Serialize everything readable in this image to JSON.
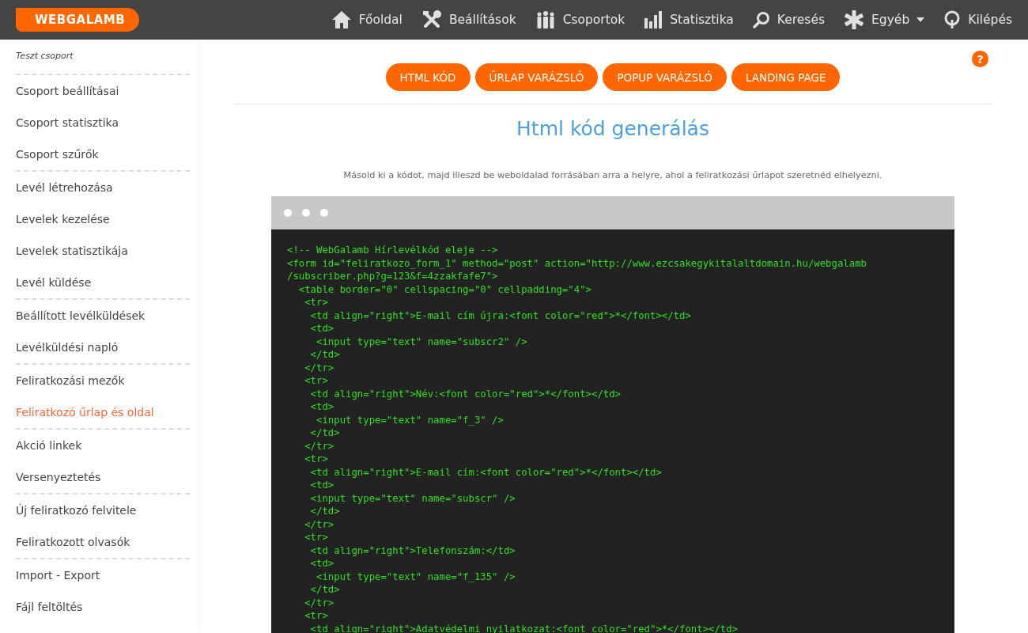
{
  "brand": {
    "logo": "WEBGALAMB"
  },
  "nav": [
    {
      "label": "Főoldal",
      "kind": "home",
      "dropdown": false
    },
    {
      "label": "Beállítások",
      "kind": "tools",
      "dropdown": false
    },
    {
      "label": "Csoportok",
      "kind": "people",
      "dropdown": false
    },
    {
      "label": "Statisztika",
      "kind": "chart",
      "dropdown": false
    },
    {
      "label": "Keresés",
      "kind": "search",
      "dropdown": false
    },
    {
      "label": "Egyéb",
      "kind": "asterisk",
      "dropdown": true
    },
    {
      "label": "Kilépés",
      "kind": "power",
      "dropdown": false
    }
  ],
  "sidebar": {
    "title": "Teszt csoport",
    "groups": [
      [
        {
          "label": "Csoport beállításai",
          "selected": false
        },
        {
          "label": "Csoport statisztika",
          "selected": false
        },
        {
          "label": "Csoport szűrők",
          "selected": false
        }
      ],
      [
        {
          "label": "Levél létrehozása",
          "selected": false
        },
        {
          "label": "Levelek kezelése",
          "selected": false
        },
        {
          "label": "Levelek statisztikája",
          "selected": false
        },
        {
          "label": "Levél küldése",
          "selected": false
        }
      ],
      [
        {
          "label": "Beállított levélküldések",
          "selected": false
        },
        {
          "label": "Levélküldési napló",
          "selected": false
        }
      ],
      [
        {
          "label": "Feliratkozási mezők",
          "selected": false
        },
        {
          "label": "Feliratkozó űrlap és oldal",
          "selected": true
        }
      ],
      [
        {
          "label": "Akció linkek",
          "selected": false
        },
        {
          "label": "Versenyeztetés",
          "selected": false
        }
      ],
      [
        {
          "label": "Új feliratkozó felvitele",
          "selected": false
        },
        {
          "label": "Feliratkozott olvasók",
          "selected": false
        }
      ],
      [
        {
          "label": "Import - Export",
          "selected": false
        },
        {
          "label": "Fájl feltöltés",
          "selected": false
        }
      ]
    ]
  },
  "help": {
    "label": "?"
  },
  "tabs": [
    "HTML KÓD",
    "ŰRLAP VARÁZSLÓ",
    "POPUP VARÁZSLÓ",
    "LANDING PAGE"
  ],
  "heading": "Html kód generálás",
  "instruction": "Másold ki a kódot, majd illeszd be weboldalad forrásában arra a helyre, ahol a feliratkozási űrlapot szeretnéd elhelyezni.",
  "code": [
    "<!-- WebGalamb Hírlevélkód eleje -->",
    "<form id=\"feliratkozo_form_1\" method=\"post\" action=\"http://www.ezcsakegykitalaltdomain.hu/webgalamb",
    "/subscriber.php?g=123&f=4zzakfafe7\">",
    "  <table border=\"0\" cellspacing=\"0\" cellpadding=\"4\">",
    "   <tr>",
    "    <td align=\"right\">E-mail cím újra:<font color=\"red\">*</font></td>",
    "    <td>",
    "     <input type=\"text\" name=\"subscr2\" />",
    "    </td>",
    "   </tr>",
    "   <tr>",
    "    <td align=\"right\">Név:<font color=\"red\">*</font></td>",
    "    <td>",
    "     <input type=\"text\" name=\"f_3\" />",
    "    </td>",
    "   </tr>",
    "   <tr>",
    "    <td align=\"right\">E-mail cím:<font color=\"red\">*</font></td>",
    "    <td>",
    "    <input type=\"text\" name=\"subscr\" />",
    "    </td>",
    "   </tr>",
    "   <tr>",
    "    <td align=\"right\">Telefonszám:</td>",
    "    <td>",
    "     <input type=\"text\" name=\"f_135\" />",
    "    </td>",
    "   </tr>",
    "   <tr>",
    "    <td align=\"right\">Adatvédelmi nyilatkozat:<font color=\"red\">*</font></td>"
  ]
}
